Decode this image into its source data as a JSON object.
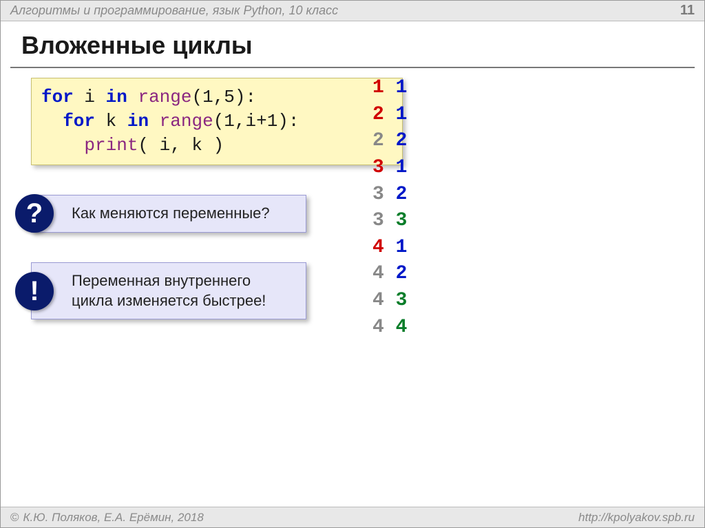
{
  "header": {
    "subject": "Алгоритмы и программирование, язык Python, 10 класс",
    "page": "11"
  },
  "title": "Вложенные циклы",
  "code": {
    "line1": {
      "for": "for",
      "i": "i",
      "in": "in",
      "range": "range",
      "args": "(1,5):"
    },
    "line2": {
      "for": "for",
      "k": "k",
      "in": "in",
      "range": "range",
      "args": "(1,i+1):"
    },
    "line3": {
      "print": "print",
      "args": "( i, k )"
    }
  },
  "callouts": {
    "question": "Как меняются переменные?",
    "exclaim": "Переменная внутреннего цикла изменяется быстрее!"
  },
  "output": [
    {
      "i": "1",
      "k": "1",
      "ifade": false,
      "kgreen": false
    },
    {
      "i": "2",
      "k": "1",
      "ifade": false,
      "kgreen": false
    },
    {
      "i": "2",
      "k": "2",
      "ifade": true,
      "kgreen": false
    },
    {
      "i": "3",
      "k": "1",
      "ifade": false,
      "kgreen": false
    },
    {
      "i": "3",
      "k": "2",
      "ifade": true,
      "kgreen": false
    },
    {
      "i": "3",
      "k": "3",
      "ifade": true,
      "kgreen": true
    },
    {
      "i": "4",
      "k": "1",
      "ifade": false,
      "kgreen": false
    },
    {
      "i": "4",
      "k": "2",
      "ifade": true,
      "kgreen": false
    },
    {
      "i": "4",
      "k": "3",
      "ifade": true,
      "kgreen": true
    },
    {
      "i": "4",
      "k": "4",
      "ifade": true,
      "kgreen": true
    }
  ],
  "footer": {
    "copy": "К.Ю. Поляков, Е.А. Ерёмин, 2018",
    "url": "http://kpolyakov.spb.ru"
  },
  "badges": {
    "q": "?",
    "e": "!"
  }
}
